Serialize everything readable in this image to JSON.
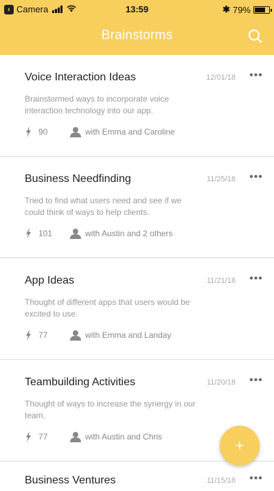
{
  "status_bar": {
    "back_app": "Camera",
    "time": "13:59",
    "battery": "79%",
    "battery_level": 0.79
  },
  "nav": {
    "title": "Brainstorms",
    "search_icon": "search-icon"
  },
  "cards": [
    {
      "title": "Voice Interaction Ideas",
      "date": "12/01/18",
      "description": "Brainstormed ways to incorporate voice interaction technology into our app.",
      "score": "90",
      "collaborators": "with Emma and Caroline"
    },
    {
      "title": "Business Needfinding",
      "date": "11/25/18",
      "description": "Tried to find what users need and see if we could think of ways to help clients.",
      "score": "101",
      "collaborators": "with Austin and 2 others"
    },
    {
      "title": "App Ideas",
      "date": "11/21/18",
      "description": "Thought of different apps that users would be excited to use.",
      "score": "77",
      "collaborators": "with Emma and Landay"
    },
    {
      "title": "Teambuilding Activities",
      "date": "11/20/18",
      "description": "Thought of ways to increase the synergy in our team.",
      "score": "77",
      "collaborators": "with Austin and Chris"
    },
    {
      "title": "Business Ventures",
      "date": "11/15/18"
    }
  ],
  "more_label": "•••",
  "fab_label": "+",
  "colors": {
    "accent": "#f8cf5c",
    "title_text": "#222222",
    "muted_text": "#999999"
  }
}
